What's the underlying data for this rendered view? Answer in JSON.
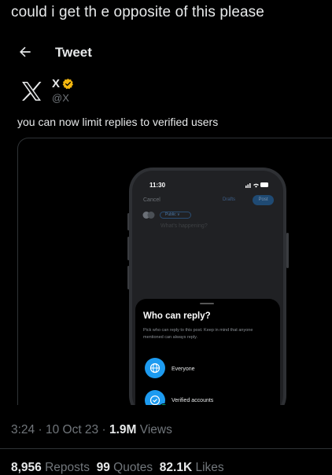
{
  "caption": "could i get th e opposite of this please",
  "header": {
    "title": "Tweet",
    "back_icon": "arrow-left-icon"
  },
  "author": {
    "name": "X",
    "handle": "@X",
    "avatar_icon": "x-logo-icon",
    "badge_icon": "gold-verified-badge-icon"
  },
  "tweet": {
    "text": "you can now limit replies to verified users"
  },
  "media": {
    "status_time": "11:30",
    "compose": {
      "cancel": "Cancel",
      "drafts": "Drafts",
      "post": "Post",
      "audience": "Public ∨",
      "placeholder": "What's happening?"
    },
    "sheet": {
      "title": "Who can reply?",
      "description": "Pick who can reply to this post. Keep in mind that anyone mentioned can always reply.",
      "options": [
        {
          "label": "Everyone",
          "icon": "globe-icon"
        },
        {
          "label": "Verified accounts",
          "icon": "verified-check-icon",
          "selected": true
        }
      ]
    }
  },
  "meta": {
    "time": "3:24",
    "separator": "·",
    "date": "10 Oct 23",
    "views_count": "1.9M",
    "views_label": "Views"
  },
  "stats": {
    "reposts_count": "8,956",
    "reposts_label": "Reposts",
    "quotes_count": "99",
    "quotes_label": "Quotes",
    "likes_count": "82.1K",
    "likes_label": "Likes"
  },
  "colors": {
    "background": "#000000",
    "text": "#e7e9ea",
    "muted": "#71767b",
    "accent": "#1d9bf0",
    "badge": "#f4b70f",
    "success": "#00ba7c"
  }
}
